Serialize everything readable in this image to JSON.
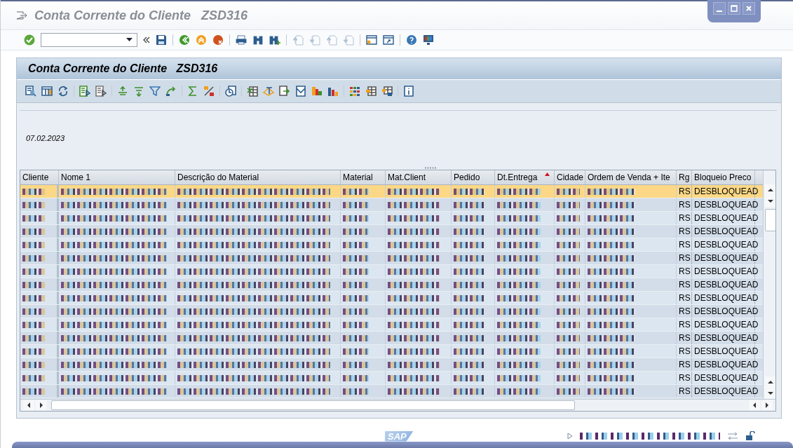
{
  "window": {
    "title": "Conta Corrente do Cliente   ZSD316"
  },
  "nav_buttons": [
    {
      "disabled": true
    },
    {
      "disabled": true
    },
    {
      "disabled": true
    },
    {
      "disabled": true
    }
  ],
  "panel": {
    "title": "Conta Corrente do Cliente   ZSD316",
    "date": "07.02.2023"
  },
  "table": {
    "columns": [
      {
        "label": "Cliente",
        "kind": "masked",
        "sorted": false
      },
      {
        "label": "Nome 1",
        "kind": "masked",
        "sorted": false
      },
      {
        "label": "Descrição do Material",
        "kind": "masked",
        "sorted": false
      },
      {
        "label": "Material",
        "kind": "masked",
        "sorted": false
      },
      {
        "label": "Mat.Client",
        "kind": "masked",
        "sorted": false
      },
      {
        "label": "Pedido",
        "kind": "masked",
        "sorted": false
      },
      {
        "label": "Dt.Entrega",
        "kind": "masked",
        "sorted": true
      },
      {
        "label": "Cidade",
        "kind": "masked",
        "sorted": false
      },
      {
        "label": "Ordem de Venda + Ite",
        "kind": "masked",
        "sorted": false
      },
      {
        "label": "Rg",
        "kind": "text",
        "sorted": false
      },
      {
        "label": "Bloqueio Preco",
        "kind": "text",
        "sorted": false
      }
    ],
    "rows": [
      {
        "selected": true,
        "cells": [
          "RS",
          "DESBLOQUEAD"
        ]
      },
      {
        "selected": false,
        "cells": [
          "RS",
          "DESBLOQUEAD"
        ]
      },
      {
        "selected": false,
        "cells": [
          "RS",
          "DESBLOQUEAD"
        ]
      },
      {
        "selected": false,
        "cells": [
          "RS",
          "DESBLOQUEAD"
        ]
      },
      {
        "selected": false,
        "cells": [
          "RS",
          "DESBLOQUEAD"
        ]
      },
      {
        "selected": false,
        "cells": [
          "RS",
          "DESBLOQUEAD"
        ]
      },
      {
        "selected": false,
        "cells": [
          "RS",
          "DESBLOQUEAD"
        ]
      },
      {
        "selected": false,
        "cells": [
          "RS",
          "DESBLOQUEAD"
        ]
      },
      {
        "selected": false,
        "cells": [
          "RS",
          "DESBLOQUEAD"
        ]
      },
      {
        "selected": false,
        "cells": [
          "RS",
          "DESBLOQUEAD"
        ]
      },
      {
        "selected": false,
        "cells": [
          "RS",
          "DESBLOQUEAD"
        ]
      },
      {
        "selected": false,
        "cells": [
          "RS",
          "DESBLOQUEAD"
        ]
      },
      {
        "selected": false,
        "cells": [
          "RS",
          "DESBLOQUEAD"
        ]
      },
      {
        "selected": false,
        "cells": [
          "RS",
          "DESBLOQUEAD"
        ]
      },
      {
        "selected": false,
        "cells": [
          "RS",
          "DESBLOQUEAD"
        ]
      },
      {
        "selected": false,
        "cells": [
          "RS",
          "DESBLOQUEAD"
        ]
      }
    ]
  },
  "status_bar": {
    "logo": "SAP"
  }
}
